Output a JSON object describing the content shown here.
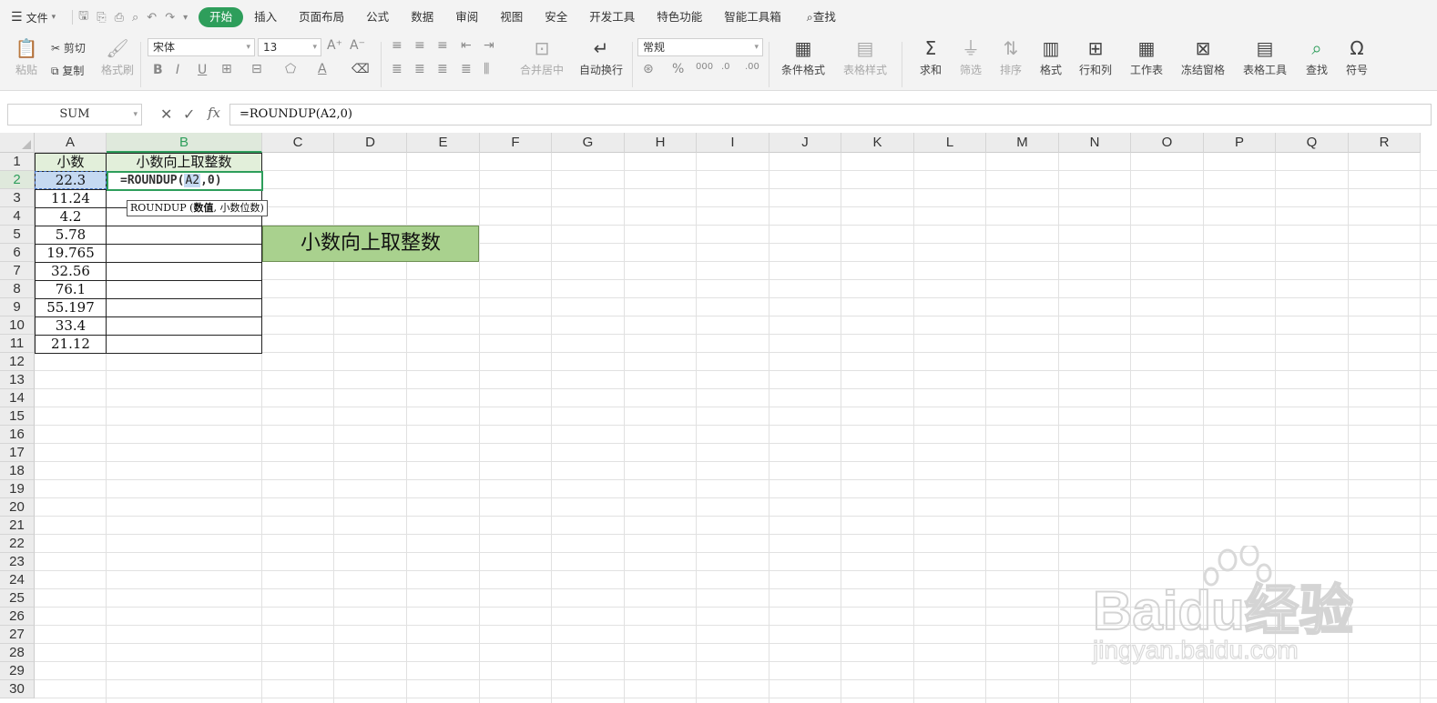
{
  "menubar": {
    "file_label": "文件",
    "tabs": [
      {
        "label": "开始",
        "active": true
      },
      {
        "label": "插入"
      },
      {
        "label": "页面布局"
      },
      {
        "label": "公式"
      },
      {
        "label": "数据"
      },
      {
        "label": "审阅"
      },
      {
        "label": "视图"
      },
      {
        "label": "安全"
      },
      {
        "label": "开发工具"
      },
      {
        "label": "特色功能"
      },
      {
        "label": "智能工具箱"
      }
    ],
    "search_label": "查找"
  },
  "ribbon": {
    "paste": "粘贴",
    "cut": "剪切",
    "copy": "复制",
    "format_painter": "格式刷",
    "font_name": "宋体",
    "font_size": "13",
    "merge_center": "合并居中",
    "wrap_text": "自动换行",
    "number_format": "常规",
    "conditional_format": "条件格式",
    "table_style": "表格样式",
    "sum": "求和",
    "filter": "筛选",
    "sort": "排序",
    "format": "格式",
    "row_col": "行和列",
    "worksheet": "工作表",
    "freeze": "冻结窗格",
    "table_tools": "表格工具",
    "find": "查找",
    "symbol": "符号"
  },
  "formula_bar": {
    "name_box": "SUM",
    "formula": "=ROUNDUP(A2,0)"
  },
  "columns": [
    "A",
    "B",
    "C",
    "D",
    "E",
    "F",
    "G",
    "H",
    "I",
    "J",
    "K",
    "L",
    "M",
    "N",
    "O",
    "P",
    "Q",
    "R"
  ],
  "rows": [
    "1",
    "2",
    "3",
    "4",
    "5",
    "6",
    "7",
    "8",
    "9",
    "10",
    "11",
    "12",
    "13",
    "14",
    "15",
    "16",
    "17",
    "18",
    "19",
    "20",
    "21",
    "22",
    "23",
    "24",
    "25",
    "26",
    "27",
    "28",
    "29",
    "30"
  ],
  "sheet": {
    "header_a": "小数",
    "header_b": "小数向上取整数",
    "decimals": [
      "22.3",
      "11.24",
      "4.2",
      "5.78",
      "19.765",
      "32.56",
      "76.1",
      "55.197",
      "33.4",
      "21.12"
    ],
    "edit_prefix": "=ROUNDUP(",
    "edit_ref": "A2",
    "edit_suffix": ",0)",
    "tooltip_fn": "ROUNDUP",
    "tooltip_arg1": "数值",
    "tooltip_arg2": "小数位数",
    "title_box": "小数向上取整数"
  },
  "watermark": {
    "brand": "Baidu经验",
    "url": "jingyan.baidu.com"
  },
  "colors": {
    "accent": "#2e9e5b",
    "header_fill": "#e2efda",
    "title_fill": "#a9d18e",
    "ref_highlight": "#c5d9f1"
  }
}
